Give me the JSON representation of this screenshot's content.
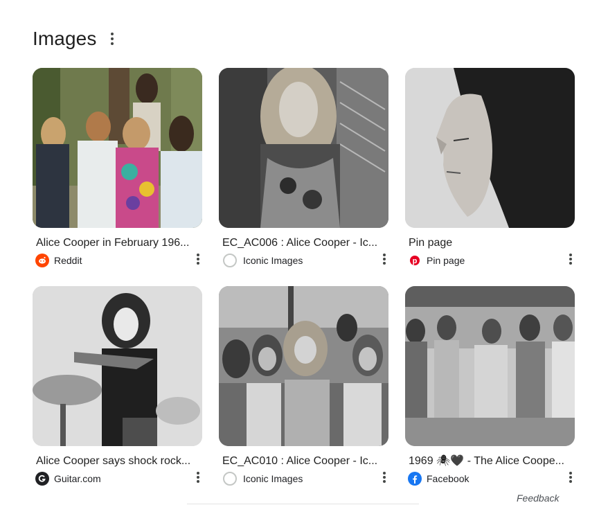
{
  "section": {
    "title": "Images"
  },
  "results": [
    {
      "caption": "Alice Cooper in February 196...",
      "source": "Reddit",
      "favicon": "reddit-icon",
      "favicon_color": "#ff4500"
    },
    {
      "caption": "EC_AC006 : Alice Cooper - Ic...",
      "source": "Iconic Images",
      "favicon": "iconic-images-icon",
      "favicon_color": "#9aa0a6"
    },
    {
      "caption": "Pin page",
      "source": "Pin page",
      "favicon": "pinterest-icon",
      "favicon_color": "#e60023"
    },
    {
      "caption": "Alice Cooper says shock rock...",
      "source": "Guitar.com",
      "favicon": "guitar-com-icon",
      "favicon_color": "#202124"
    },
    {
      "caption": "EC_AC010 : Alice Cooper - Ic...",
      "source": "Iconic Images",
      "favicon": "iconic-images-icon",
      "favicon_color": "#9aa0a6"
    },
    {
      "caption": "1969 🕷🖤 - The Alice Coope...",
      "source": "Facebook",
      "favicon": "facebook-icon",
      "favicon_color": "#1877f2"
    }
  ],
  "footer": {
    "feedback": "Feedback"
  }
}
